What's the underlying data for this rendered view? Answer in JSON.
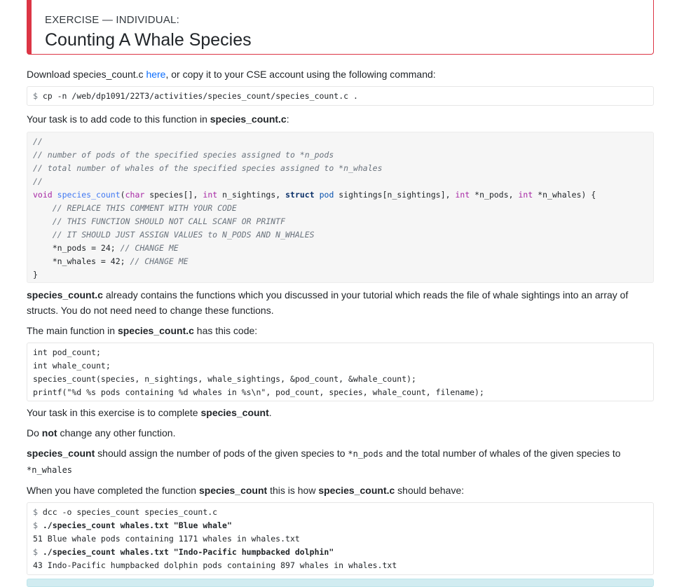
{
  "header": {
    "kicker": "EXERCISE — INDIVIDUAL:",
    "title": "Counting A Whale Species"
  },
  "intro": {
    "before": "Download species_count.c ",
    "link": "here",
    "after": ", or copy it to your CSE account using the following command:"
  },
  "copy_command": {
    "prompt": "$",
    "command": " cp -n /web/dp1091/22T3/activities/species_count/species_count.c ."
  },
  "task_intro": {
    "before": "Your task is to add code to this function in ",
    "bold": "species_count.c",
    "after": ":"
  },
  "function_code": {
    "lines": [
      "//",
      "// number of pods of the specified species assigned to *n_pods",
      "// total number of whales of the specified species assigned to *n_whales",
      "//"
    ],
    "signature": {
      "void": "void",
      "name": "species_count",
      "p1": "(",
      "char": "char",
      "p2": " species[], ",
      "int1": "int",
      "p3": " n_sightings, ",
      "struct": "struct",
      "pod": "pod",
      "p4": " sightings[n_sightings], ",
      "int2": "int",
      "p5": " *n_pods, ",
      "int3": "int",
      "p6": " *n_whales) {"
    },
    "body_comments": [
      "    // REPLACE THIS COMMENT WITH YOUR CODE",
      "    // THIS FUNCTION SHOULD NOT CALL SCANF OR PRINTF",
      "    // IT SHOULD JUST ASSIGN VALUES to N_PODS AND N_WHALES"
    ],
    "assign1": {
      "code": "    *n_pods = 24; ",
      "comment": "// CHANGE ME"
    },
    "assign2": {
      "code": "    *n_whales = 42; ",
      "comment": "// CHANGE ME"
    },
    "close": "}"
  },
  "already": {
    "bold": "species_count.c",
    "rest": " already contains the functions which you discussed in your tutorial which reads the file of whale sightings into an array of structs. You do not need need to change these functions."
  },
  "main_intro": {
    "before": "The main function in ",
    "bold": "species_count.c",
    "after": " has this code:"
  },
  "main_code": {
    "lines": [
      "int pod_count;",
      "int whale_count;",
      "species_count(species, n_sightings, whale_sightings, &pod_count, &whale_count);",
      "printf(\"%d %s pods containing %d whales in %s\\n\", pod_count, species, whale_count, filename);"
    ]
  },
  "complete": {
    "before": "Your task in this exercise is to complete ",
    "bold": "species_count",
    "after": "."
  },
  "donot": {
    "before": "Do ",
    "bold": "not",
    "after": " change any other function."
  },
  "assign_desc": {
    "bold": "species_count",
    "mid": " should assign the number of pods of the given species to ",
    "code1": "*n_pods",
    "mid2": " and the total number of whales of the given species to ",
    "code2": "*n_whales"
  },
  "behave": {
    "before": "When you have completed the function ",
    "bold1": "species_count",
    "mid": " this is how ",
    "bold2": "species_count.c",
    "after": " should behave:"
  },
  "session": {
    "prompt": "$",
    "cmd1": " dcc -o species_count species_count.c",
    "cmd2": " ./species_count whales.txt \"Blue whale\"",
    "out1": "51 Blue whale pods containing 1171 whales in whales.txt",
    "cmd3": " ./species_count whales.txt \"Indo-Pacific humpbacked dolphin\"",
    "out2": "43 Indo-Pacific humpbacked dolphin pods containing 897 whales in whales.txt"
  },
  "colors": {
    "header_accent": "#dc3545",
    "link": "#0d6efd",
    "info_bar": "#d1ecf1"
  }
}
